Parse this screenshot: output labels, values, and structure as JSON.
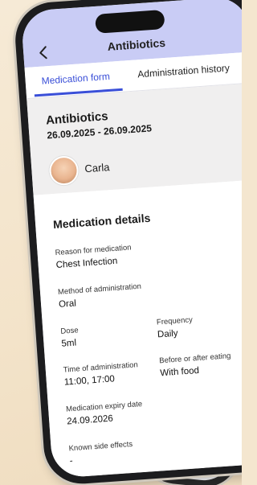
{
  "header": {
    "title": "Antibiotics"
  },
  "tabs": [
    {
      "label": "Medication form"
    },
    {
      "label": "Administration history"
    }
  ],
  "summary": {
    "name": "Antibiotics",
    "dates": "26.09.2025 - 26.09.2025",
    "person": "Carla"
  },
  "details": {
    "section_title": "Medication details",
    "reason_label": "Reason for medication",
    "reason_value": "Chest Infection",
    "method_label": "Method of administration",
    "method_value": "Oral",
    "dose_label": "Dose",
    "dose_value": "5ml",
    "frequency_label": "Frequency",
    "frequency_value": "Daily",
    "time_label": "Time of administration",
    "time_value": "11:00, 17:00",
    "eating_label": "Before or after eating",
    "eating_value": "With food",
    "expiry_label": "Medication expiry date",
    "expiry_value": "24.09.2026",
    "side_effects_label": "Known side effects",
    "side_effects_value": "-"
  },
  "colors": {
    "header_bg": "#c9ccf5",
    "accent": "#3a4fd8"
  }
}
